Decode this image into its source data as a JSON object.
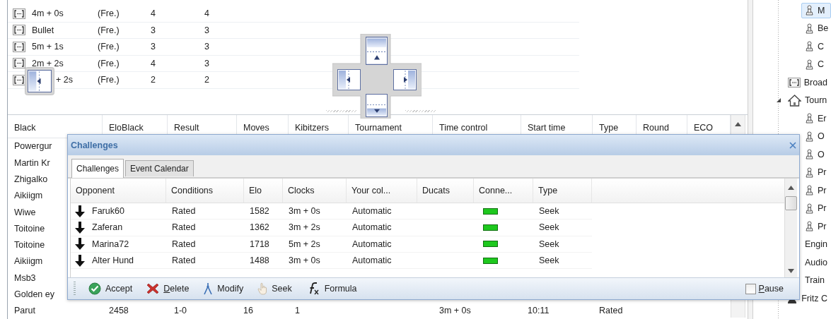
{
  "top_table": {
    "rows": [
      {
        "time_control": "4m + 0s",
        "mode": "(Fre.)",
        "column_3": "4",
        "column_4": "4"
      },
      {
        "time_control": "Bullet",
        "mode": "(Fre.)",
        "column_3": "3",
        "column_4": "3"
      },
      {
        "time_control": "5m + 1s",
        "mode": "(Fre.)",
        "column_3": "3",
        "column_4": "3"
      },
      {
        "time_control": "2m + 2s",
        "mode": "(Fre.)",
        "column_3": "4",
        "column_4": "3"
      },
      {
        "time_control": "+ 2s",
        "mode": "(Fre.)",
        "column_3": "2",
        "column_4": "2"
      }
    ]
  },
  "games_table": {
    "columns": [
      "Black",
      "EloBlack",
      "Result",
      "Moves",
      "Kibitzers",
      "Tournament",
      "Time control",
      "Start time",
      "Type",
      "Round",
      "ECO"
    ],
    "rows": [
      {
        "black": "Powergur"
      },
      {
        "black": "Martin Kr"
      },
      {
        "black": "Zhigalko"
      },
      {
        "black": "Aikiigm"
      },
      {
        "black": "Wiwe"
      },
      {
        "black": "Toitoine"
      },
      {
        "black": "Toitoine"
      },
      {
        "black": "Aikiigm"
      },
      {
        "black": "Msb3"
      },
      {
        "black": "Golden ey"
      },
      {
        "black": "Parut",
        "elo_black": "2458",
        "result": "1-0",
        "moves": "16",
        "kibitzers": "1",
        "time_control": "3m + 0s",
        "start_time": "10:11",
        "type": "Rated"
      }
    ]
  },
  "challenges_dialog": {
    "title": "Challenges",
    "tabs": [
      {
        "label": "Challenges",
        "selected": true
      },
      {
        "label": "Event Calendar",
        "selected": false
      }
    ],
    "columns": [
      "Opponent",
      "Conditions",
      "Elo",
      "Clocks",
      "Your col...",
      "Ducats",
      "Conne...",
      "Type"
    ],
    "rows": [
      {
        "opponent": "Faruk60",
        "conditions": "Rated",
        "elo": "1582",
        "clocks": "3m + 0s",
        "your_color": "Automatic",
        "color": "#1ec81e",
        "type": "Seek"
      },
      {
        "opponent": "Zaferan",
        "conditions": "Rated",
        "elo": "1362",
        "clocks": "3m + 2s",
        "your_color": "Automatic",
        "color": "#1ec81e",
        "type": "Seek"
      },
      {
        "opponent": "Marina72",
        "conditions": "Rated",
        "elo": "1718",
        "clocks": "5m + 2s",
        "your_color": "Automatic",
        "color": "#1ec81e",
        "type": "Seek"
      },
      {
        "opponent": "Alter Hund",
        "conditions": "Rated",
        "elo": "1488",
        "clocks": "3m + 0s",
        "your_color": "Automatic",
        "color": "#1ec81e",
        "type": "Seek"
      }
    ],
    "toolbar": [
      {
        "kind": "accept",
        "label": "Accept",
        "mnemonic": false
      },
      {
        "kind": "delete",
        "label": "Delete",
        "mnemonic": true
      },
      {
        "kind": "modify",
        "label": "Modify",
        "mnemonic": false
      },
      {
        "kind": "seek",
        "label": "Seek",
        "mnemonic": false
      },
      {
        "kind": "formula",
        "label": "Formula",
        "mnemonic": false
      }
    ],
    "pause": {
      "label": "Pause",
      "checked": false,
      "mnemonic": true
    }
  },
  "tree": {
    "continued_items": [
      {
        "label": "M",
        "kind": "pawn",
        "selected": true
      },
      {
        "label": "Be",
        "kind": "pawn",
        "selected": false
      },
      {
        "label": "C",
        "kind": "pawn",
        "selected": false
      },
      {
        "label": "C",
        "kind": "pawn",
        "selected": false
      }
    ],
    "items": [
      {
        "label": "Broad",
        "kind": "broadcast",
        "selected": false
      },
      {
        "label": "Tourn",
        "kind": "home",
        "selected": false,
        "expanded": true,
        "children": [
          {
            "label": "Er",
            "kind": "pawn",
            "selected": false
          },
          {
            "label": "O",
            "kind": "pawn",
            "selected": false
          },
          {
            "label": "O",
            "kind": "pawn",
            "selected": false
          },
          {
            "label": "Pr",
            "kind": "pawn",
            "selected": false
          },
          {
            "label": "Pr",
            "kind": "pawn",
            "selected": false
          },
          {
            "label": "Pr",
            "kind": "pawn",
            "selected": false
          },
          {
            "label": "Pr",
            "kind": "pawn",
            "selected": false
          }
        ]
      },
      {
        "label": "Engin",
        "kind": "plain",
        "selected": false
      },
      {
        "label": "Audio",
        "kind": "plain",
        "selected": false
      },
      {
        "label": "Train",
        "kind": "plain",
        "selected": false
      },
      {
        "label": "Fritz C",
        "kind": "person",
        "selected": false
      }
    ]
  }
}
